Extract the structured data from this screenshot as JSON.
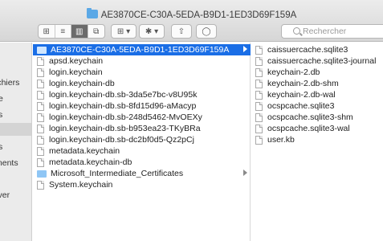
{
  "window": {
    "title": "AE3870CE-C30A-5EDA-B9D1-1ED3D69F159A"
  },
  "toolbar": {
    "view_icons": [
      "⊞",
      "≡",
      "▥",
      "⧉"
    ],
    "arrange_glyph": "⊞ ▾",
    "action_glyph": "✱ ▾",
    "share_glyph": "⇧",
    "tag_glyph": "◯",
    "search_placeholder": "Rechercher"
  },
  "sidebar": {
    "fragments": [
      "ichiers",
      "e",
      "s",
      "s",
      "ments",
      "rver"
    ]
  },
  "column1": {
    "selected": "AE3870CE-C30A-5EDA-B9D1-1ED3D69F159A",
    "items": [
      "apsd.keychain",
      "login.keychain",
      "login.keychain-db",
      "login.keychain-db.sb-3da5e7bc-v8U95k",
      "login.keychain-db.sb-8fd15d96-aMacyp",
      "login.keychain-db.sb-248d5462-MvOEXy",
      "login.keychain-db.sb-b953ea23-TKyBRa",
      "login.keychain-db.sb-dc2bf0d5-Qz2pCj",
      "metadata.keychain",
      "metadata.keychain-db",
      "Microsoft_Intermediate_Certificates",
      "System.keychain"
    ]
  },
  "column2": {
    "items": [
      "caissuercache.sqlite3",
      "caissuercache.sqlite3-journal",
      "keychain-2.db",
      "keychain-2.db-shm",
      "keychain-2.db-wal",
      "ocspcache.sqlite3",
      "ocspcache.sqlite3-shm",
      "ocspcache.sqlite3-wal",
      "user.kb"
    ]
  },
  "colors": {
    "selection": "#1a6ee6",
    "folder": "#8fc6f5"
  }
}
